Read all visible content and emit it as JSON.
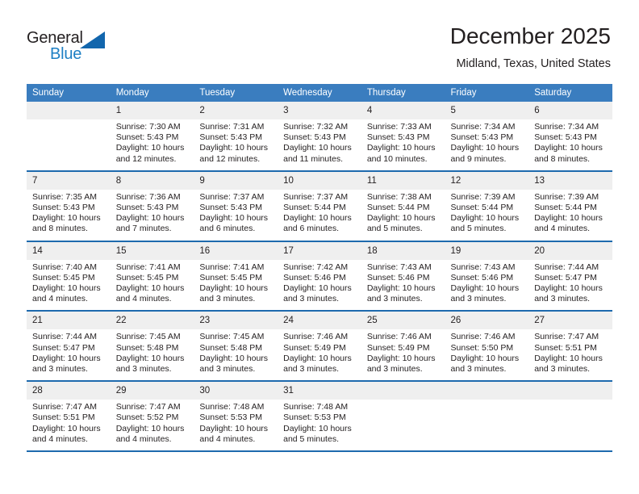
{
  "logo": {
    "word_one": "General",
    "word_two": "Blue",
    "accent_color": "#1266ad",
    "text_color": "#231f20"
  },
  "header": {
    "title": "December 2025",
    "subtitle": "Midland, Texas, United States"
  },
  "theme": {
    "header_bg": "#3a7dbf",
    "header_text": "#ffffff",
    "row_rule": "#1e6aae",
    "daynum_bg": "#efefef",
    "body_text": "#231f20"
  },
  "calendar": {
    "weekday_headers": [
      "Sunday",
      "Monday",
      "Tuesday",
      "Wednesday",
      "Thursday",
      "Friday",
      "Saturday"
    ],
    "weeks": [
      [
        {
          "day": "",
          "lines": []
        },
        {
          "day": "1",
          "lines": [
            "Sunrise: 7:30 AM",
            "Sunset: 5:43 PM",
            "Daylight: 10 hours",
            "and 12 minutes."
          ]
        },
        {
          "day": "2",
          "lines": [
            "Sunrise: 7:31 AM",
            "Sunset: 5:43 PM",
            "Daylight: 10 hours",
            "and 12 minutes."
          ]
        },
        {
          "day": "3",
          "lines": [
            "Sunrise: 7:32 AM",
            "Sunset: 5:43 PM",
            "Daylight: 10 hours",
            "and 11 minutes."
          ]
        },
        {
          "day": "4",
          "lines": [
            "Sunrise: 7:33 AM",
            "Sunset: 5:43 PM",
            "Daylight: 10 hours",
            "and 10 minutes."
          ]
        },
        {
          "day": "5",
          "lines": [
            "Sunrise: 7:34 AM",
            "Sunset: 5:43 PM",
            "Daylight: 10 hours",
            "and 9 minutes."
          ]
        },
        {
          "day": "6",
          "lines": [
            "Sunrise: 7:34 AM",
            "Sunset: 5:43 PM",
            "Daylight: 10 hours",
            "and 8 minutes."
          ]
        }
      ],
      [
        {
          "day": "7",
          "lines": [
            "Sunrise: 7:35 AM",
            "Sunset: 5:43 PM",
            "Daylight: 10 hours",
            "and 8 minutes."
          ]
        },
        {
          "day": "8",
          "lines": [
            "Sunrise: 7:36 AM",
            "Sunset: 5:43 PM",
            "Daylight: 10 hours",
            "and 7 minutes."
          ]
        },
        {
          "day": "9",
          "lines": [
            "Sunrise: 7:37 AM",
            "Sunset: 5:43 PM",
            "Daylight: 10 hours",
            "and 6 minutes."
          ]
        },
        {
          "day": "10",
          "lines": [
            "Sunrise: 7:37 AM",
            "Sunset: 5:44 PM",
            "Daylight: 10 hours",
            "and 6 minutes."
          ]
        },
        {
          "day": "11",
          "lines": [
            "Sunrise: 7:38 AM",
            "Sunset: 5:44 PM",
            "Daylight: 10 hours",
            "and 5 minutes."
          ]
        },
        {
          "day": "12",
          "lines": [
            "Sunrise: 7:39 AM",
            "Sunset: 5:44 PM",
            "Daylight: 10 hours",
            "and 5 minutes."
          ]
        },
        {
          "day": "13",
          "lines": [
            "Sunrise: 7:39 AM",
            "Sunset: 5:44 PM",
            "Daylight: 10 hours",
            "and 4 minutes."
          ]
        }
      ],
      [
        {
          "day": "14",
          "lines": [
            "Sunrise: 7:40 AM",
            "Sunset: 5:45 PM",
            "Daylight: 10 hours",
            "and 4 minutes."
          ]
        },
        {
          "day": "15",
          "lines": [
            "Sunrise: 7:41 AM",
            "Sunset: 5:45 PM",
            "Daylight: 10 hours",
            "and 4 minutes."
          ]
        },
        {
          "day": "16",
          "lines": [
            "Sunrise: 7:41 AM",
            "Sunset: 5:45 PM",
            "Daylight: 10 hours",
            "and 3 minutes."
          ]
        },
        {
          "day": "17",
          "lines": [
            "Sunrise: 7:42 AM",
            "Sunset: 5:46 PM",
            "Daylight: 10 hours",
            "and 3 minutes."
          ]
        },
        {
          "day": "18",
          "lines": [
            "Sunrise: 7:43 AM",
            "Sunset: 5:46 PM",
            "Daylight: 10 hours",
            "and 3 minutes."
          ]
        },
        {
          "day": "19",
          "lines": [
            "Sunrise: 7:43 AM",
            "Sunset: 5:46 PM",
            "Daylight: 10 hours",
            "and 3 minutes."
          ]
        },
        {
          "day": "20",
          "lines": [
            "Sunrise: 7:44 AM",
            "Sunset: 5:47 PM",
            "Daylight: 10 hours",
            "and 3 minutes."
          ]
        }
      ],
      [
        {
          "day": "21",
          "lines": [
            "Sunrise: 7:44 AM",
            "Sunset: 5:47 PM",
            "Daylight: 10 hours",
            "and 3 minutes."
          ]
        },
        {
          "day": "22",
          "lines": [
            "Sunrise: 7:45 AM",
            "Sunset: 5:48 PM",
            "Daylight: 10 hours",
            "and 3 minutes."
          ]
        },
        {
          "day": "23",
          "lines": [
            "Sunrise: 7:45 AM",
            "Sunset: 5:48 PM",
            "Daylight: 10 hours",
            "and 3 minutes."
          ]
        },
        {
          "day": "24",
          "lines": [
            "Sunrise: 7:46 AM",
            "Sunset: 5:49 PM",
            "Daylight: 10 hours",
            "and 3 minutes."
          ]
        },
        {
          "day": "25",
          "lines": [
            "Sunrise: 7:46 AM",
            "Sunset: 5:49 PM",
            "Daylight: 10 hours",
            "and 3 minutes."
          ]
        },
        {
          "day": "26",
          "lines": [
            "Sunrise: 7:46 AM",
            "Sunset: 5:50 PM",
            "Daylight: 10 hours",
            "and 3 minutes."
          ]
        },
        {
          "day": "27",
          "lines": [
            "Sunrise: 7:47 AM",
            "Sunset: 5:51 PM",
            "Daylight: 10 hours",
            "and 3 minutes."
          ]
        }
      ],
      [
        {
          "day": "28",
          "lines": [
            "Sunrise: 7:47 AM",
            "Sunset: 5:51 PM",
            "Daylight: 10 hours",
            "and 4 minutes."
          ]
        },
        {
          "day": "29",
          "lines": [
            "Sunrise: 7:47 AM",
            "Sunset: 5:52 PM",
            "Daylight: 10 hours",
            "and 4 minutes."
          ]
        },
        {
          "day": "30",
          "lines": [
            "Sunrise: 7:48 AM",
            "Sunset: 5:53 PM",
            "Daylight: 10 hours",
            "and 4 minutes."
          ]
        },
        {
          "day": "31",
          "lines": [
            "Sunrise: 7:48 AM",
            "Sunset: 5:53 PM",
            "Daylight: 10 hours",
            "and 5 minutes."
          ]
        },
        {
          "day": "",
          "lines": []
        },
        {
          "day": "",
          "lines": []
        },
        {
          "day": "",
          "lines": []
        }
      ]
    ]
  }
}
